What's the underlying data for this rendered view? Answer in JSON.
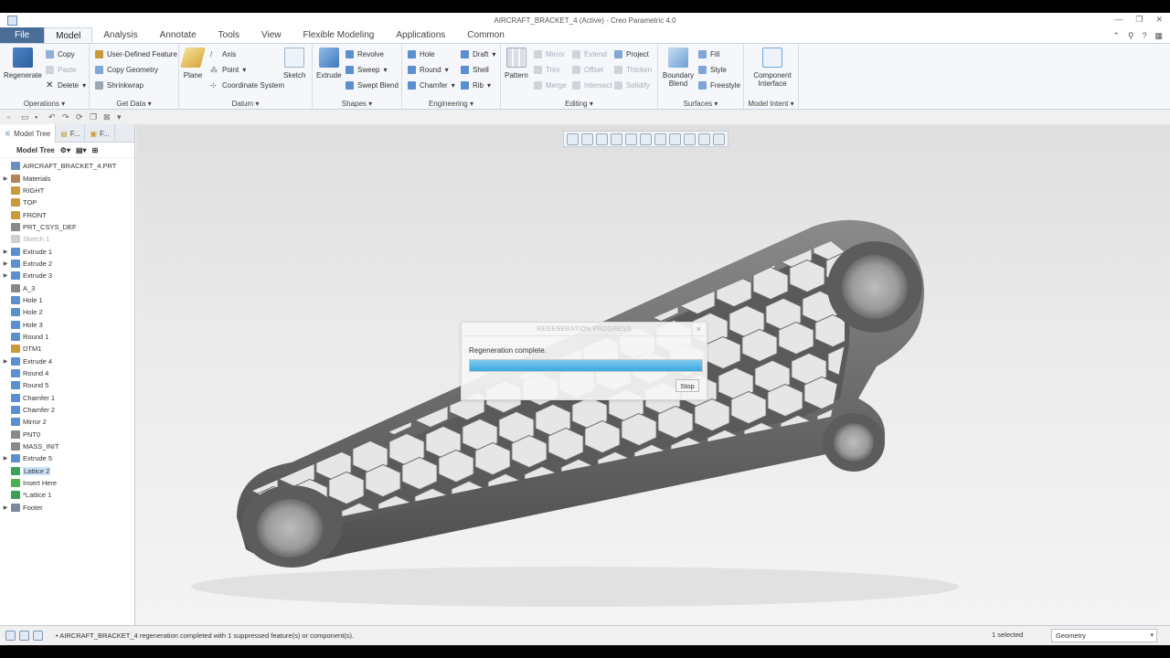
{
  "window": {
    "title": "AIRCRAFT_BRACKET_4 (Active) - Creo Parametric 4.0"
  },
  "menu": {
    "tabs": [
      "File",
      "Model",
      "Analysis",
      "Annotate",
      "Tools",
      "View",
      "Flexible Modeling",
      "Applications",
      "Common"
    ],
    "active": "Model"
  },
  "ribbon": {
    "operations": {
      "label": "Operations",
      "regenerate": "Regenerate",
      "copy": "Copy",
      "paste": "Paste",
      "delete": "Delete"
    },
    "get_data": {
      "label": "Get Data",
      "udf": "User-Defined Feature",
      "copy_geometry": "Copy Geometry",
      "shrinkwrap": "Shrinkwrap"
    },
    "datum": {
      "label": "Datum",
      "plane": "Plane",
      "axis": "Axis",
      "point": "Point",
      "csys": "Coordinate System",
      "sketch": "Sketch"
    },
    "shapes": {
      "label": "Shapes",
      "extrude": "Extrude",
      "revolve": "Revolve",
      "sweep": "Sweep",
      "swept_blend": "Swept Blend"
    },
    "engineering": {
      "label": "Engineering",
      "hole": "Hole",
      "round": "Round",
      "chamfer": "Chamfer",
      "draft": "Draft",
      "shell": "Shell",
      "rib": "Rib"
    },
    "editing": {
      "label": "Editing",
      "pattern": "Pattern",
      "mirror": "Mirror",
      "trim": "Trim",
      "merge": "Merge",
      "extend": "Extend",
      "offset": "Offset",
      "intersect": "Intersect",
      "project": "Project",
      "thicken": "Thicken",
      "solidify": "Solidify"
    },
    "surfaces": {
      "label": "Surfaces",
      "boundary_blend": "Boundary Blend",
      "fill": "Fill",
      "style": "Style",
      "freestyle": "Freestyle"
    },
    "model_intent": {
      "label": "Model Intent",
      "component_interface": "Component Interface"
    }
  },
  "panel": {
    "tab_model_tree": "Model Tree",
    "tab_folder": "F...",
    "tab_fav": "F...",
    "tree_header": "Model Tree"
  },
  "tree": [
    {
      "label": "AIRCRAFT_BRACKET_4.PRT",
      "exp": "",
      "icon": "#6a8fc2",
      "state": "root"
    },
    {
      "label": "Materials",
      "exp": "▶",
      "icon": "#b0855a",
      "state": ""
    },
    {
      "label": "RIGHT",
      "exp": "",
      "icon": "#c89a3c",
      "state": ""
    },
    {
      "label": "TOP",
      "exp": "",
      "icon": "#c89a3c",
      "state": ""
    },
    {
      "label": "FRONT",
      "exp": "",
      "icon": "#c89a3c",
      "state": ""
    },
    {
      "label": "PRT_CSYS_DEF",
      "exp": "",
      "icon": "#8a8a8a",
      "state": ""
    },
    {
      "label": "Sketch 1",
      "exp": "",
      "icon": "#cfcfcf",
      "state": "grey"
    },
    {
      "label": "Extrude 1",
      "exp": "▶",
      "icon": "#5b8fd0",
      "state": ""
    },
    {
      "label": "Extrude 2",
      "exp": "▶",
      "icon": "#5b8fd0",
      "state": ""
    },
    {
      "label": "Extrude 3",
      "exp": "▶",
      "icon": "#5b8fd0",
      "state": ""
    },
    {
      "label": "A_3",
      "exp": "",
      "icon": "#888888",
      "state": ""
    },
    {
      "label": "Hole 1",
      "exp": "",
      "icon": "#5b8fd0",
      "state": ""
    },
    {
      "label": "Hole 2",
      "exp": "",
      "icon": "#5b8fd0",
      "state": ""
    },
    {
      "label": "Hole 3",
      "exp": "",
      "icon": "#5b8fd0",
      "state": ""
    },
    {
      "label": "Round 1",
      "exp": "",
      "icon": "#5b8fd0",
      "state": ""
    },
    {
      "label": "DTM1",
      "exp": "",
      "icon": "#c89a3c",
      "state": ""
    },
    {
      "label": "Extrude 4",
      "exp": "▶",
      "icon": "#5b8fd0",
      "state": ""
    },
    {
      "label": "Round 4",
      "exp": "",
      "icon": "#5b8fd0",
      "state": ""
    },
    {
      "label": "Round 5",
      "exp": "",
      "icon": "#5b8fd0",
      "state": ""
    },
    {
      "label": "Chamfer 1",
      "exp": "",
      "icon": "#5b8fd0",
      "state": ""
    },
    {
      "label": "Chamfer 2",
      "exp": "",
      "icon": "#5b8fd0",
      "state": ""
    },
    {
      "label": "Mirror 2",
      "exp": "",
      "icon": "#5b8fd0",
      "state": ""
    },
    {
      "label": "PNT0",
      "exp": "",
      "icon": "#8a8a8a",
      "state": ""
    },
    {
      "label": "MASS_INIT",
      "exp": "",
      "icon": "#8a8a8a",
      "state": ""
    },
    {
      "label": "Extrude 5",
      "exp": "▶",
      "icon": "#5b8fd0",
      "state": ""
    },
    {
      "label": "Lattice 2",
      "exp": "",
      "icon": "#3aa05a",
      "state": "sel"
    },
    {
      "label": "Insert Here",
      "exp": "",
      "icon": "#4caf50",
      "state": ""
    },
    {
      "label": "*Lattice 1",
      "exp": "",
      "icon": "#3aa05a",
      "state": ""
    },
    {
      "label": "Footer",
      "exp": "▶",
      "icon": "#7a8a9a",
      "state": ""
    }
  ],
  "dialog": {
    "title": "REGENERATION PROGRESS",
    "message": "Regeneration complete.",
    "progress": 1.0,
    "stop": "Stop",
    "close": "×"
  },
  "status": {
    "message": "• AIRCRAFT_BRACKET_4 regeneration completed with 1 suppressed feature(s) or component(s).",
    "selected": "1 selected",
    "filter": "Geometry"
  },
  "colors": {
    "file_tab": "#4a6d98",
    "progress": "#3da8e0",
    "selection": "#c9e2f8",
    "part": "#6e6e6e"
  }
}
